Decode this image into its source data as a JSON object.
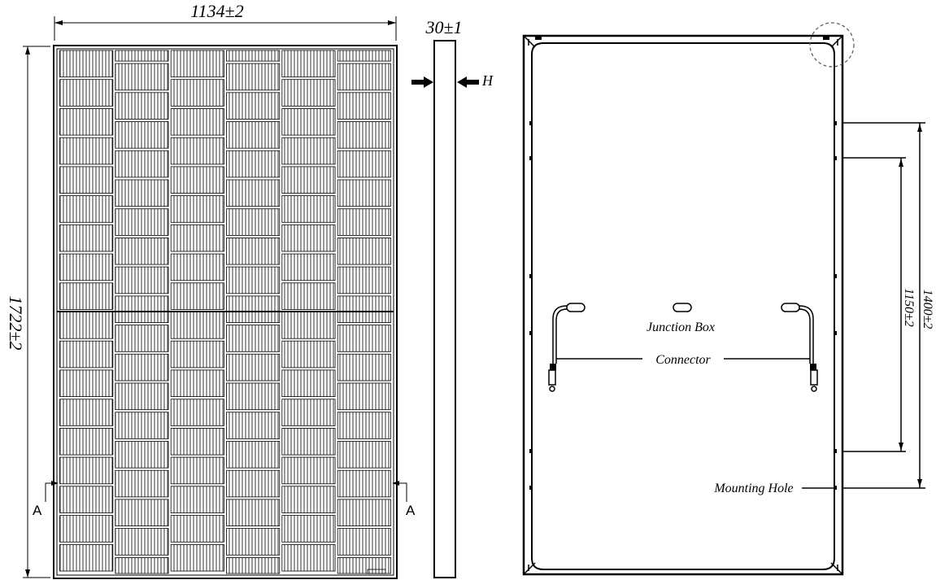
{
  "dimensions": {
    "width": "1134±2",
    "height": "1722±2",
    "thickness": "30±1",
    "frame_label": "H",
    "outer_hole_spacing": "1400±2",
    "inner_hole_spacing": "1150±2"
  },
  "section": {
    "left": "A",
    "right": "A"
  },
  "labels": {
    "junction_box": "Junction Box",
    "connector": "Connector",
    "mounting_hole": "Mounting Hole"
  },
  "front_panel": {
    "columns": 6,
    "rows": 18
  },
  "colors": {
    "line": "#000000",
    "background": "#ffffff",
    "detail_circle": "#555555"
  }
}
